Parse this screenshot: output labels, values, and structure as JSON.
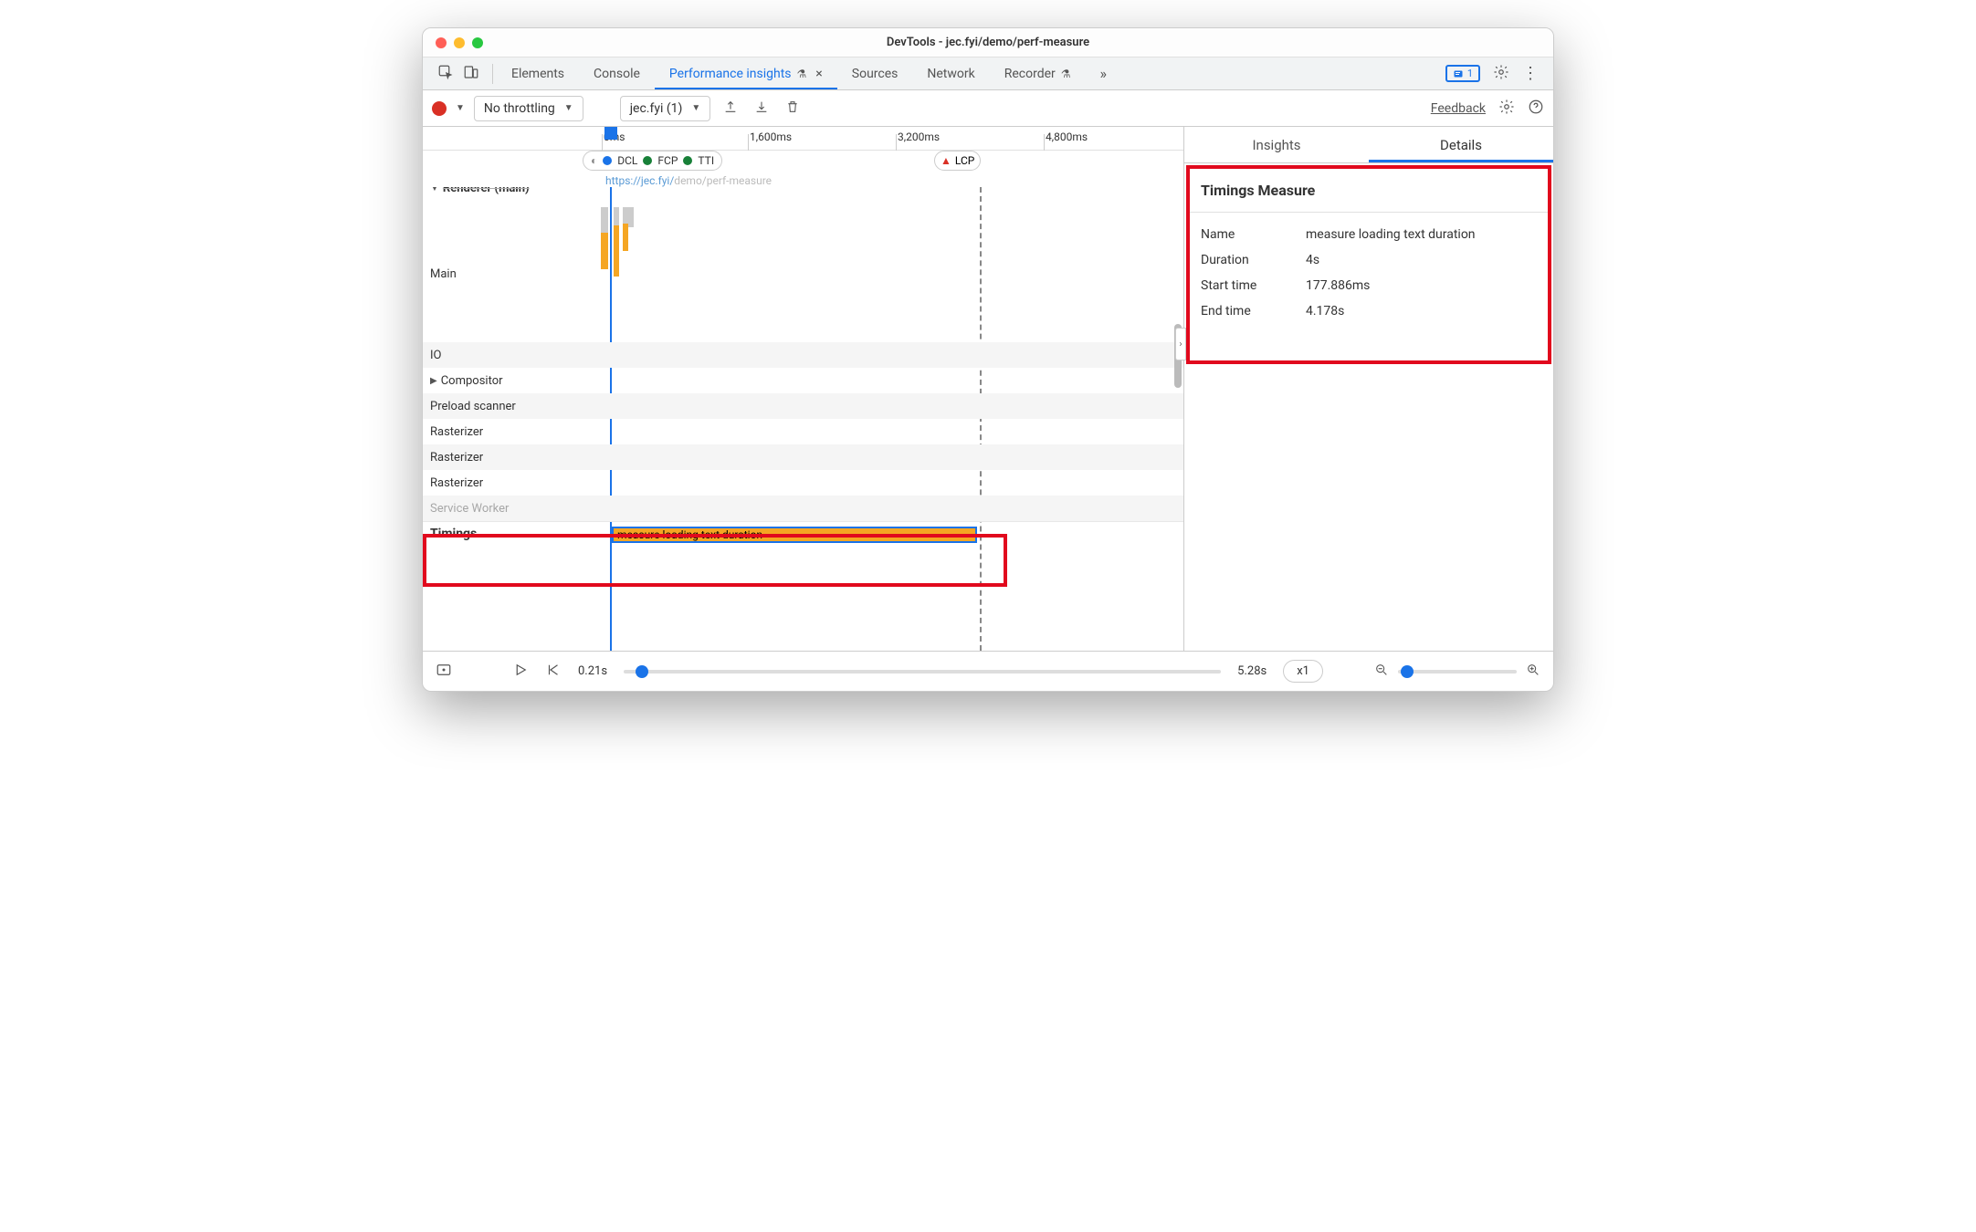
{
  "window": {
    "title": "DevTools - jec.fyi/demo/perf-measure"
  },
  "tabs": {
    "elements": "Elements",
    "console": "Console",
    "perf_insights": "Performance insights",
    "sources": "Sources",
    "network": "Network",
    "recorder": "Recorder",
    "issues_count": "1"
  },
  "toolbar": {
    "throttle": "No throttling",
    "recording": "jec.fyi (1)",
    "feedback": "Feedback"
  },
  "ruler": {
    "t0": "0ms",
    "t1": "1,600ms",
    "t2": "3,200ms",
    "t3": "4,800ms"
  },
  "markers": {
    "dcl": "DCL",
    "fcp": "FCP",
    "tti": "TTI",
    "lcp": "LCP"
  },
  "url_strip": {
    "prefix": "https://jec.fyi/",
    "path": "demo/perf-measure"
  },
  "tracks": {
    "renderer": "Renderer (main)",
    "main": "Main",
    "io": "IO",
    "compositor": "Compositor",
    "preload": "Preload scanner",
    "rasterizer": "Rasterizer",
    "service_worker": "Service Worker",
    "timings": "Timings"
  },
  "timings_measure": {
    "bar_label": "measure loading text duration"
  },
  "right_pane": {
    "insights": "Insights",
    "details": "Details",
    "panel_title": "Timings Measure",
    "rows": {
      "name_k": "Name",
      "name_v": "measure loading text duration",
      "dur_k": "Duration",
      "dur_v": "4s",
      "start_k": "Start time",
      "start_v": "177.886ms",
      "end_k": "End time",
      "end_v": "4.178s"
    }
  },
  "bottom": {
    "start": "0.21s",
    "end": "5.28s",
    "speed": "x1"
  }
}
